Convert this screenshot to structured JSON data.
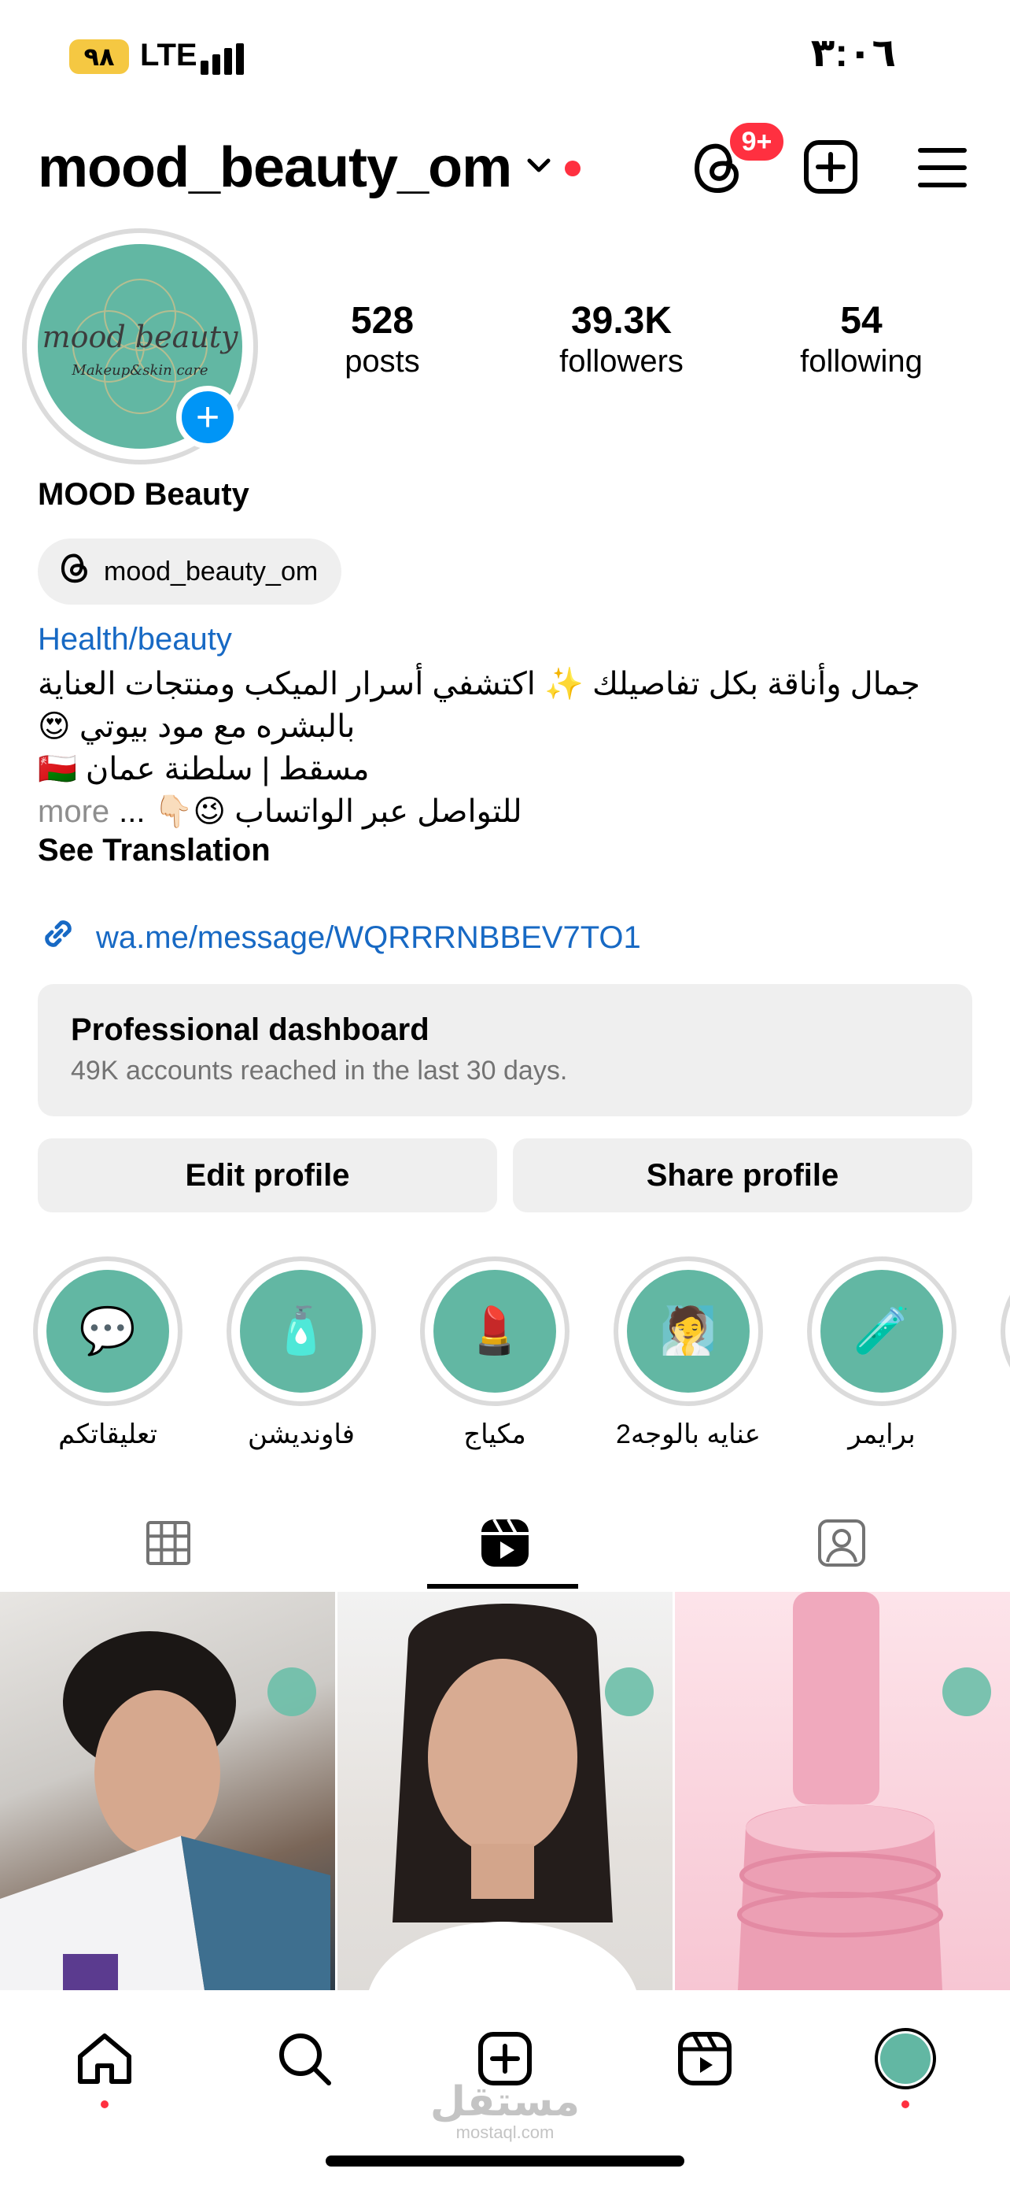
{
  "status_bar": {
    "time": "٣:٠٦",
    "battery": "٩٨",
    "network": "LTE"
  },
  "header": {
    "username": "mood_beauty_om",
    "notification_badge": "9+"
  },
  "profile": {
    "avatar_logo_line1": "mood beauty",
    "avatar_logo_line2": "Makeup&skin care",
    "stats": [
      {
        "number": "528",
        "label": "posts"
      },
      {
        "number": "39.3K",
        "label": "followers"
      },
      {
        "number": "54",
        "label": "following"
      }
    ],
    "display_name": "MOOD Beauty",
    "threads_handle": "mood_beauty_om",
    "category": "Health/beauty",
    "bio_lines": [
      "جمال وأناقة بكل تفاصيلك ✨ اكتشفي أسرار الميكب ومنتجات العناية",
      "بالبشره مع مود بيوتي 😍",
      "مسقط | سلطنة عمان 🇴🇲",
      "للتواصل عبر الواتساب 😉👇🏻 ..."
    ],
    "bio_more": "more",
    "see_translation": "See Translation",
    "link": "wa.me/message/WQRRRNBBEV7TO1"
  },
  "dashboard": {
    "title": "Professional dashboard",
    "subtitle": "49K accounts reached in the last 30 days."
  },
  "buttons": {
    "edit": "Edit profile",
    "share": "Share profile"
  },
  "highlights": [
    {
      "label": "تعليقاتكم",
      "icon": "comments-icon"
    },
    {
      "label": "فاونديشن",
      "icon": "foundation-icon"
    },
    {
      "label": "مكياج",
      "icon": "makeup-girl-icon"
    },
    {
      "label": "عنايه بالوجه2",
      "icon": "face-mask-icon"
    },
    {
      "label": "برايمر",
      "icon": "primer-tube-icon"
    }
  ],
  "tabs": [
    "grid-icon",
    "reels-icon",
    "tagged-icon"
  ],
  "active_tab": "reels",
  "watermark": {
    "arabic": "مستقل",
    "latin": "mostaql.com"
  },
  "colors": {
    "accent_blue": "#0095f6",
    "link_blue": "#1769c4",
    "badge_red": "#ff3040",
    "brand_teal": "#62b7a3"
  }
}
